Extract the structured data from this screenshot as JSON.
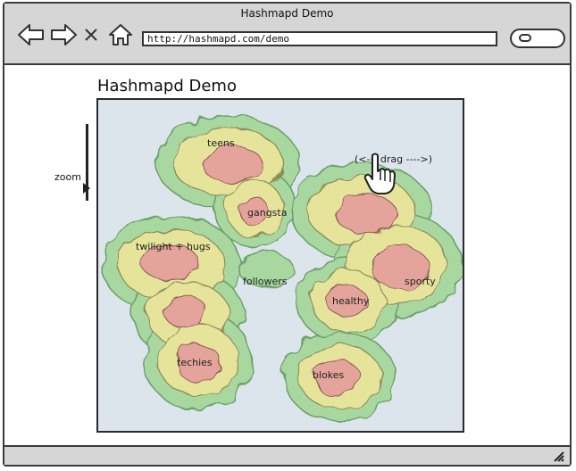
{
  "window": {
    "title": "Hashmapd Demo"
  },
  "toolbar": {
    "url": "http://hashmapd.com/demo",
    "back_icon": "back-arrow-icon",
    "forward_icon": "forward-arrow-icon",
    "stop_icon": "close-icon",
    "home_icon": "home-icon",
    "search_icon": "search-icon"
  },
  "page": {
    "title": "Hashmapd Demo"
  },
  "zoom": {
    "label": "zoom"
  },
  "map": {
    "drag_hint": "(<--- drag ---->)",
    "regions": [
      {
        "label": "teens"
      },
      {
        "label": "gangsta"
      },
      {
        "label": "twilight + hugs"
      },
      {
        "label": "followers"
      },
      {
        "label": "techies"
      },
      {
        "label": "healthy"
      },
      {
        "label": "sporty"
      },
      {
        "label": "blokes"
      }
    ],
    "colors": {
      "background": "#dde5ec",
      "outer": "#a8d8a0",
      "mid": "#e6e49a",
      "core": "#e4a49c"
    }
  }
}
